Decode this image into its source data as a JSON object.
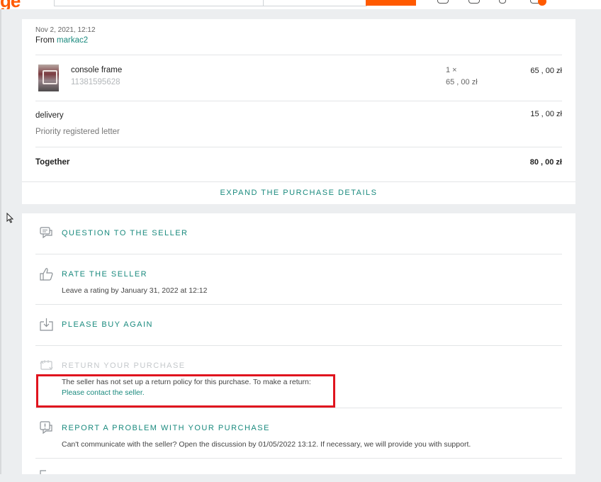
{
  "header": {
    "logo": "ge",
    "icons": [
      "cart-icon",
      "bell-icon",
      "user-icon",
      "notification-icon"
    ],
    "accent": "#ff5a00"
  },
  "order": {
    "date": "Nov 2, 2021, 12:12",
    "from_label": "From",
    "seller": "markac2",
    "item": {
      "title": "console frame",
      "id": "11381595628",
      "quantity": "1 ×",
      "unit_price": "65 , 00 zł",
      "price": "65 , 00 zł"
    },
    "delivery": {
      "label": "delivery",
      "method": "Priority registered letter",
      "price": "15 , 00 zł"
    },
    "total": {
      "label": "Together",
      "price": "80 , 00 zł"
    },
    "expand_label": "EXPAND THE PURCHASE DETAILS"
  },
  "actions": {
    "question": {
      "title": "QUESTION TO THE SELLER"
    },
    "rate": {
      "title": "RATE THE SELLER",
      "subtitle": "Leave a rating by January 31, 2022 at 12:12"
    },
    "buy_again": {
      "title": "PLEASE BUY AGAIN"
    },
    "return": {
      "title": "RETURN YOUR PURCHASE",
      "subtitle": "The seller has not set up a return policy for this purchase. To make a return:",
      "link": "Please contact the seller."
    },
    "report": {
      "title": "REPORT A PROBLEM WITH YOUR PURCHASE",
      "subtitle": "Can't communicate with the seller? Open the discussion by 01/05/2022 13:12. If necessary, we will provide you with support."
    }
  },
  "colors": {
    "link": "#1a8a7e",
    "highlight_border": "#e0141e",
    "background": "#eceef0"
  }
}
